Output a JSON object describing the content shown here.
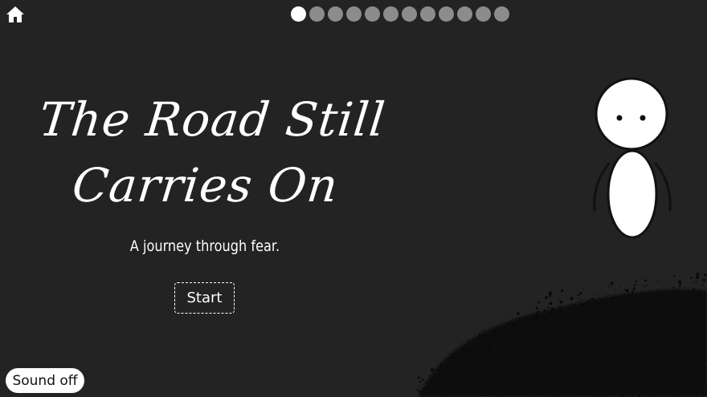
{
  "nav": {
    "home_icon": "home-icon"
  },
  "progress": {
    "total": 12,
    "current": 1
  },
  "title": {
    "line1": "The Road Still",
    "line2": "Carries On"
  },
  "subtitle": "A journey through fear.",
  "start_button": "Start",
  "sound_button": "Sound off",
  "colors": {
    "background": "#232323",
    "text": "#ffffff",
    "dot_active": "#ffffff",
    "dot_inactive": "#8c8c8c",
    "ground": "#0a0a0a"
  }
}
